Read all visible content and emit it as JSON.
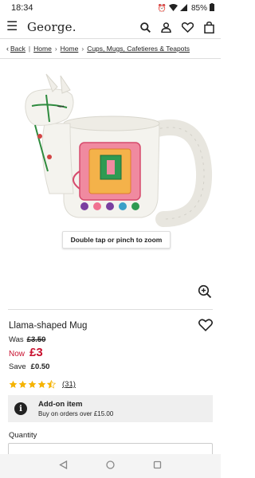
{
  "status_bar": {
    "time": "18:34",
    "battery": "85%"
  },
  "header": {
    "logo": "George."
  },
  "breadcrumb": {
    "back": "Back",
    "items": [
      "Home",
      "Home",
      "Cups, Mugs, Cafetieres & Teapots"
    ]
  },
  "gallery": {
    "zoom_hint": "Double tap or pinch to zoom"
  },
  "product": {
    "title": "Llama-shaped Mug",
    "was_label": "Was",
    "was_price": "£3.50",
    "now_label": "Now",
    "now_price": "£3",
    "save_label": "Save",
    "save_amount": "£0.50",
    "rating": 4.5,
    "review_count": "(31)"
  },
  "addon": {
    "title": "Add-on item",
    "subtitle": "Buy on orders over £15.00"
  },
  "quantity": {
    "label": "Quantity"
  },
  "colors": {
    "accent_red": "#c8102e",
    "star": "#f5b301"
  }
}
